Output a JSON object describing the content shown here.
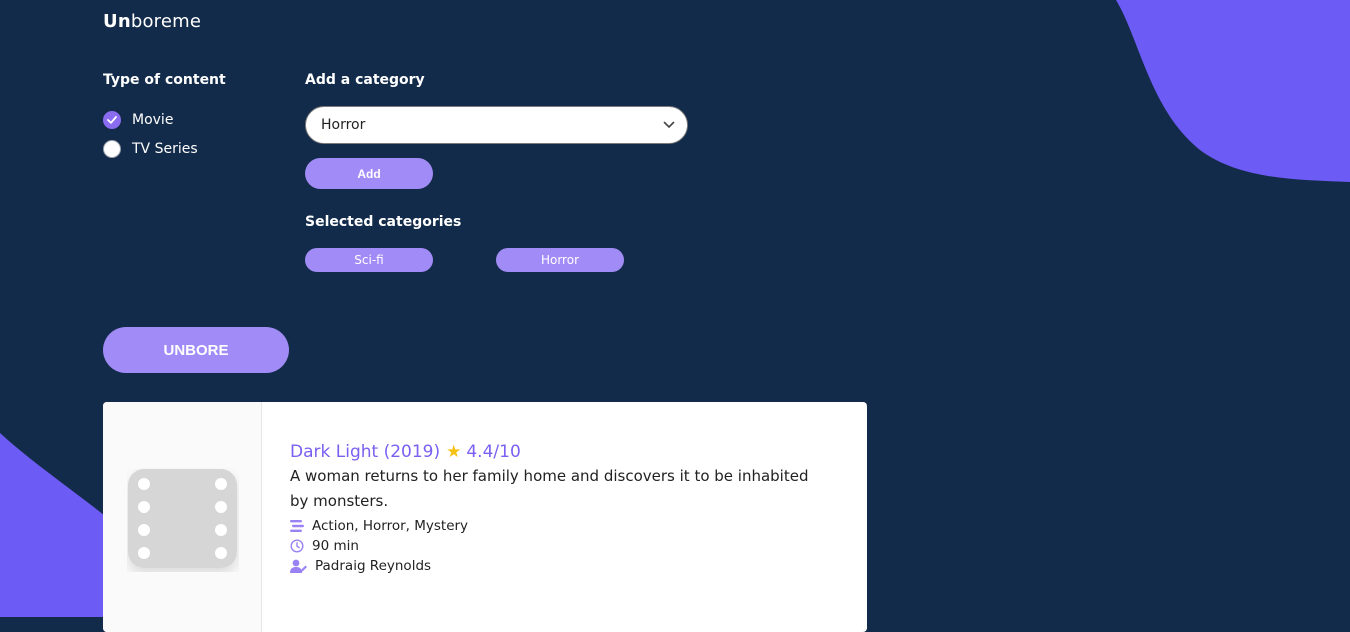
{
  "brand": {
    "strong": "Un",
    "rest": "boreme"
  },
  "content_type": {
    "heading": "Type of content",
    "options": [
      {
        "label": "Movie",
        "checked": true
      },
      {
        "label": "TV Series",
        "checked": false
      }
    ]
  },
  "category": {
    "heading": "Add a category",
    "selected_value": "Horror",
    "add_label": "Add",
    "selected_heading": "Selected categories",
    "chips": [
      "Sci-fi",
      "Horror"
    ]
  },
  "unbore_label": "UNBORE",
  "result": {
    "title": "Dark Light (2019)",
    "rating": "4.4/10",
    "description": "A woman returns to her family home and discovers it to be inhabited by monsters.",
    "genres": "Action, Horror, Mystery",
    "runtime": "90 min",
    "director": "Padraig Reynolds"
  },
  "colors": {
    "background": "#132b4a",
    "accent": "#6d5bf5",
    "button": "#a18cf7",
    "title": "#7a5ff0"
  }
}
